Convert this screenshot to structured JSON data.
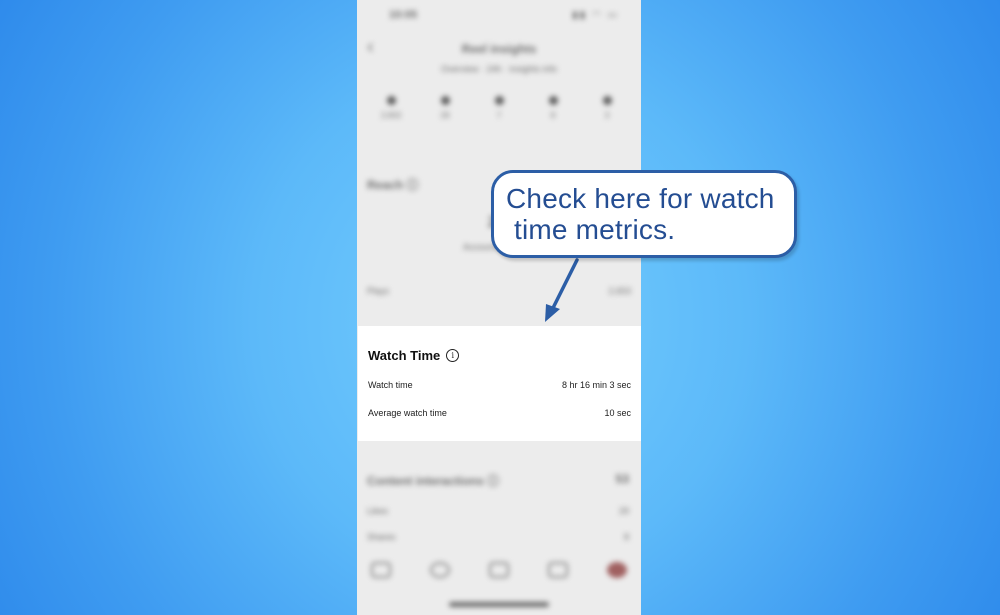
{
  "phone": {
    "status_time": "10:05",
    "status_icons": "▮▮ ◠ ▭",
    "back_icon": "chevron-left-icon",
    "page_title": "Reel insights",
    "page_subtitle": "Overview · 24h · insights info",
    "stats": [
      {
        "icon": "play-icon",
        "value": "2,653"
      },
      {
        "icon": "heart-icon",
        "value": "29"
      },
      {
        "icon": "comment-icon",
        "value": "7"
      },
      {
        "icon": "share-icon",
        "value": "8"
      },
      {
        "icon": "save-icon",
        "value": "3"
      }
    ],
    "reach_title": "Reach ⓘ",
    "reach_number": "2,1",
    "reach_label": "Accounts reached",
    "plays_label": "Plays",
    "plays_value": "2,653",
    "content_interactions_title": "Content interactions ⓘ",
    "content_interactions_count": "53",
    "ci_rows": [
      {
        "label": "Likes",
        "value": "29"
      },
      {
        "label": "Shares",
        "value": "8"
      }
    ]
  },
  "watch_time": {
    "title": "Watch Time",
    "info_icon": "i",
    "rows": [
      {
        "label": "Watch time",
        "value": "8 hr 16 min 3 sec"
      },
      {
        "label": "Average watch time",
        "value": "10 sec"
      }
    ]
  },
  "callout": {
    "line1": "Check here for watch",
    "line2": " time metrics."
  },
  "colors": {
    "callout_border": "#2c5ea6",
    "callout_text": "#244d92",
    "background_center": "#74cdfd",
    "background_edge": "#2b87ea"
  }
}
